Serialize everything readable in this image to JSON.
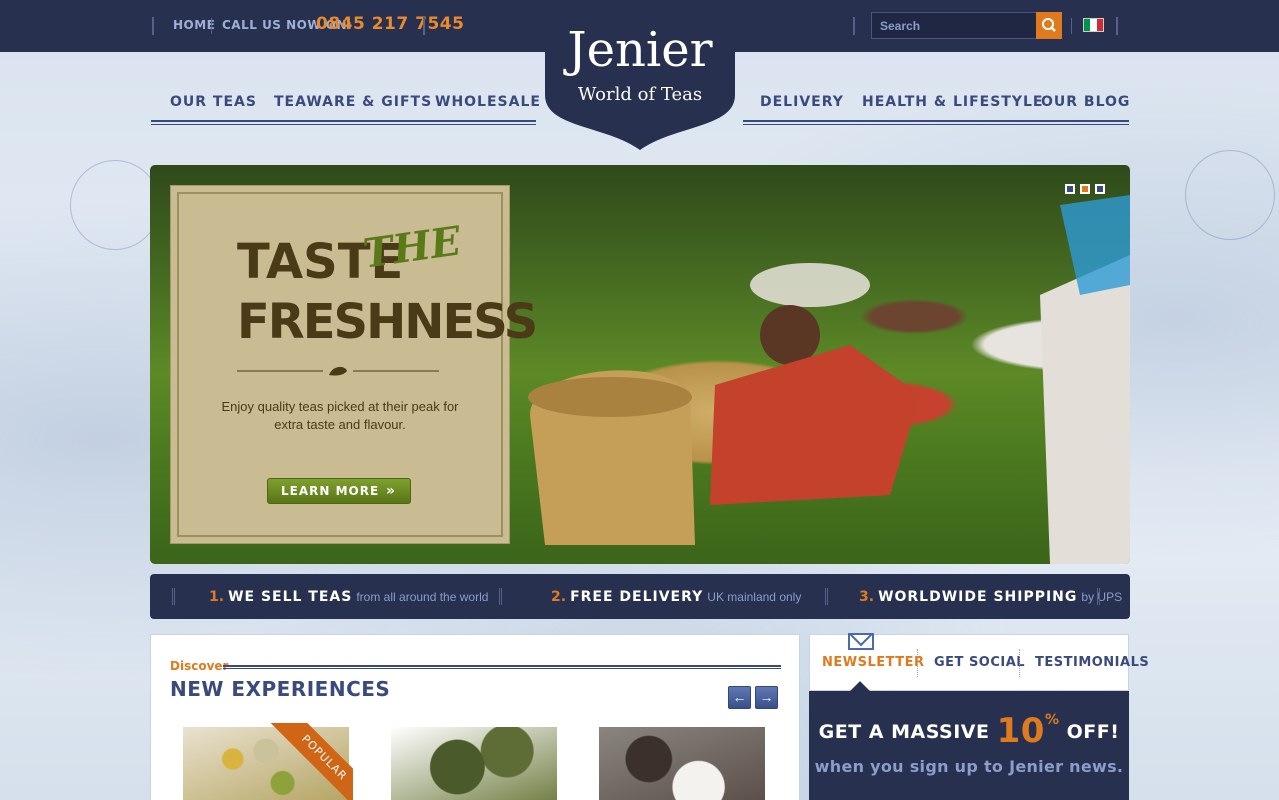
{
  "topbar": {
    "home": "HOME",
    "call_label": "CALL US NOW ON:",
    "phone": "0845 217 7545",
    "search_placeholder": "Search",
    "search_icon": "search-icon",
    "language_flag": "italian-flag-icon"
  },
  "logo": {
    "title": "Jenier",
    "subtitle": "World of Teas"
  },
  "nav": {
    "left": [
      "OUR TEAS",
      "TEAWARE & GIFTS",
      "WHOLESALE"
    ],
    "right": [
      "DELIVERY",
      "HEALTH & LIFESTYLE",
      "OUR BLOG"
    ]
  },
  "hero": {
    "line1": "TASTE",
    "accent": "THE",
    "line2": "FRESHNESS",
    "description": "Enjoy quality teas picked at their peak for extra taste and flavour.",
    "button": "LEARN MORE",
    "button_icon": "double-chevron-right-icon",
    "slides": 3,
    "active_slide": 2
  },
  "benefits": [
    {
      "num": "1.",
      "title": "WE SELL TEAS",
      "sub": "from all around the world"
    },
    {
      "num": "2.",
      "title": "FREE DELIVERY",
      "sub": "UK mainland only"
    },
    {
      "num": "3.",
      "title": "WORLDWIDE SHIPPING",
      "sub": "by UPS"
    }
  ],
  "discover": {
    "small": "Discover",
    "title": "NEW EXPERIENCES",
    "prev_icon": "arrow-left-icon",
    "next_icon": "arrow-right-icon",
    "popular_badge": "POPULAR"
  },
  "sidepanel": {
    "tabs": [
      "NEWSLETTER",
      "GET SOCIAL",
      "TESTIMONIALS"
    ],
    "active_tab": "NEWSLETTER",
    "headline_pre": "GET A MASSIVE",
    "headline_pct": "10",
    "headline_sup": "%",
    "headline_post": "OFF!",
    "subline": "when you sign up to Jenier news."
  },
  "colors": {
    "navy": "#27304f",
    "nav_text": "#3a4a7d",
    "accent_orange": "#e07a1e",
    "hero_button_green": "#6b8a22"
  }
}
